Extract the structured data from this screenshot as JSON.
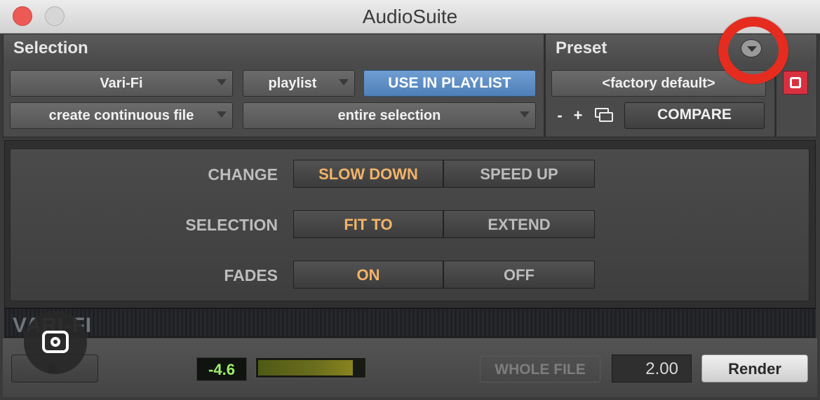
{
  "window": {
    "title": "AudioSuite"
  },
  "selection_panel": {
    "heading": "Selection",
    "plugin_select": "Vari-Fi",
    "target_select": "playlist",
    "use_in_playlist_label": "USE IN PLAYLIST",
    "file_mode_select": "create continuous file",
    "processing_select": "entire selection"
  },
  "preset_panel": {
    "heading": "Preset",
    "preset_select": "<factory default>",
    "minus_label": "-",
    "plus_label": "+",
    "compare_label": "COMPARE"
  },
  "controls": {
    "rows": [
      {
        "label": "CHANGE",
        "options": [
          "SLOW DOWN",
          "SPEED UP"
        ],
        "selected": "SLOW DOWN"
      },
      {
        "label": "SELECTION",
        "options": [
          "FIT TO",
          "EXTEND"
        ],
        "selected": "FIT TO"
      },
      {
        "label": "FADES",
        "options": [
          "ON",
          "OFF"
        ],
        "selected": "ON"
      }
    ],
    "active_color": "#f2b468",
    "inactive_color": "#bcbcbc"
  },
  "plugin_name": "VARI-FI",
  "footer": {
    "meter_value": "-4.6",
    "meter_level": 0.9,
    "whole_file_label": "WHOLE FILE",
    "ratio_value": "2.00",
    "render_label": "Render"
  },
  "accent_colors": {
    "highlight_ring": "#e52c1f",
    "bypass_button": "#d8303f",
    "use_in_playlist": "#5b8cc6"
  },
  "icons": [
    "close-button-icon",
    "minimize-button-icon",
    "preset-menu-chevron-icon",
    "bypass-icon",
    "copy-settings-icon",
    "speaker-icon",
    "lens-search-icon"
  ]
}
